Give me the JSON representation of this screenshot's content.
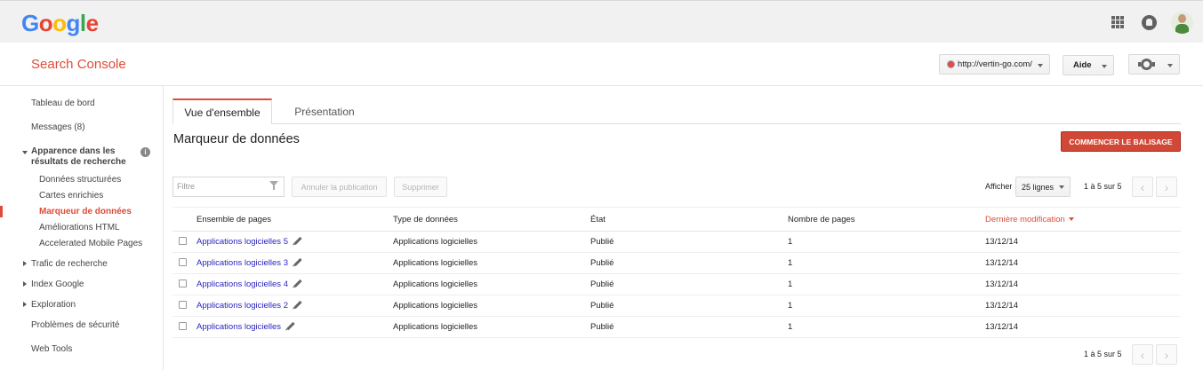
{
  "google": {
    "logo_letters": [
      {
        "char": "G",
        "color": "#4285f4"
      },
      {
        "char": "o",
        "color": "#ea4335"
      },
      {
        "char": "o",
        "color": "#fbbc05"
      },
      {
        "char": "g",
        "color": "#4285f4"
      },
      {
        "char": "l",
        "color": "#34a853"
      },
      {
        "char": "e",
        "color": "#ea4335"
      }
    ],
    "icons": [
      "apps-icon",
      "notifications-icon",
      "avatar"
    ]
  },
  "header": {
    "title": "Search Console",
    "site": "http://vertin-go.com/",
    "help": "Aide",
    "settings_icon": "gear-icon",
    "accent": "#dd4b39"
  },
  "sidebar": {
    "dashboard": "Tableau de bord",
    "messages": "Messages (8)",
    "search_appearance": "Apparence dans les résultats de recherche",
    "structured_data": "Données structurées",
    "rich_cards": "Cartes enrichies",
    "data_highlighter": "Marqueur de données",
    "html_improvements": "Améliorations HTML",
    "amp": "Accelerated Mobile Pages",
    "search_traffic": "Trafic de recherche",
    "google_index": "Index Google",
    "crawl": "Exploration",
    "security_issues": "Problèmes de sécurité",
    "web_tools": "Web Tools"
  },
  "tabs": {
    "overview": "Vue d'ensemble",
    "presentation": "Présentation"
  },
  "main": {
    "title": "Marqueur de données",
    "start_button": "COMMENCER LE BALISAGE",
    "filter_placeholder": "Filtre",
    "unpublish_button": "Annuler la publication",
    "delete_button": "Supprimer",
    "show_label": "Afficher",
    "rows_per_page": "25 lignes",
    "pagination": "1 à 5 sur 5"
  },
  "table": {
    "headers": {
      "pageset": "Ensemble de pages",
      "type": "Type de données",
      "status": "État",
      "pages": "Nombre de pages",
      "modified": "Dernière modification"
    },
    "rows": [
      {
        "pageset": "Applications logicielles 5",
        "type": "Applications logicielles",
        "status": "Publié",
        "pages": "1",
        "modified": "13/12/14"
      },
      {
        "pageset": "Applications logicielles 3",
        "type": "Applications logicielles",
        "status": "Publié",
        "pages": "1",
        "modified": "13/12/14"
      },
      {
        "pageset": "Applications logicielles 4",
        "type": "Applications logicielles",
        "status": "Publié",
        "pages": "1",
        "modified": "13/12/14"
      },
      {
        "pageset": "Applications logicielles 2",
        "type": "Applications logicielles",
        "status": "Publié",
        "pages": "1",
        "modified": "13/12/14"
      },
      {
        "pageset": "Applications logicielles",
        "type": "Applications logicielles",
        "status": "Publié",
        "pages": "1",
        "modified": "13/12/14"
      }
    ]
  }
}
